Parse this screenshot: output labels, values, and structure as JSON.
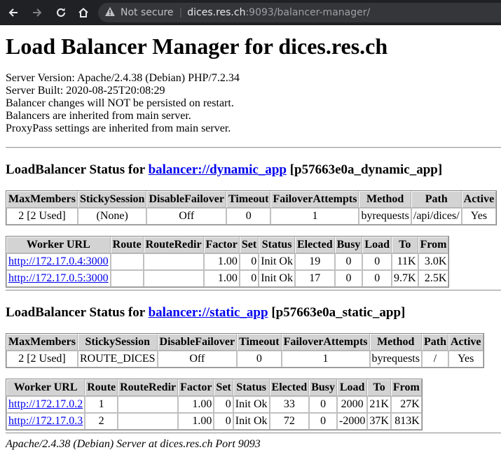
{
  "browser": {
    "not_secure": "Not secure",
    "url_host": "dices.res.ch",
    "url_path": ":9093/balancer-manager/"
  },
  "page": {
    "title": "Load Balancer Manager for dices.res.ch",
    "info_lines": [
      "Server Version: Apache/2.4.38 (Debian) PHP/7.2.34",
      "Server Built: 2020-08-25T20:08:29",
      "Balancer changes will NOT be persisted on restart.",
      "Balancers are inherited from main server.",
      "ProxyPass settings are inherited from main server."
    ],
    "footer": "Apache/2.4.38 (Debian) Server at dices.res.ch Port 9093"
  },
  "balancer_headers": [
    "MaxMembers",
    "StickySession",
    "DisableFailover",
    "Timeout",
    "FailoverAttempts",
    "Method",
    "Path",
    "Active"
  ],
  "worker_headers": [
    "Worker URL",
    "Route",
    "RouteRedir",
    "Factor",
    "Set",
    "Status",
    "Elected",
    "Busy",
    "Load",
    "To",
    "From"
  ],
  "balancers": [
    {
      "heading_prefix": "LoadBalancer Status for ",
      "link": "balancer://dynamic_app",
      "heading_suffix": " [p57663e0a_dynamic_app]",
      "summary": [
        "2 [2 Used]",
        "(None)",
        "Off",
        "0",
        "1",
        "byrequests",
        "/api/dices/",
        "Yes"
      ],
      "workers": [
        [
          "http://172.17.0.4:3000",
          "",
          "",
          "1.00",
          "0",
          "Init Ok",
          "19",
          "0",
          "0",
          "11K",
          "3.0K"
        ],
        [
          "http://172.17.0.5:3000",
          "",
          "",
          "1.00",
          "0",
          "Init Ok",
          "17",
          "0",
          "0",
          "9.7K",
          "2.5K"
        ]
      ]
    },
    {
      "heading_prefix": "LoadBalancer Status for ",
      "link": "balancer://static_app",
      "heading_suffix": " [p57663e0a_static_app]",
      "summary": [
        "2 [2 Used]",
        "ROUTE_DICES",
        "Off",
        "0",
        "1",
        "byrequests",
        "/",
        "Yes"
      ],
      "workers": [
        [
          "http://172.17.0.2",
          "1",
          "",
          "1.00",
          "0",
          "Init Ok",
          "33",
          "0",
          "2000",
          "21K",
          "27K"
        ],
        [
          "http://172.17.0.3",
          "2",
          "",
          "1.00",
          "0",
          "Init Ok",
          "72",
          "0",
          "-2000",
          "37K",
          "813K"
        ]
      ]
    }
  ]
}
